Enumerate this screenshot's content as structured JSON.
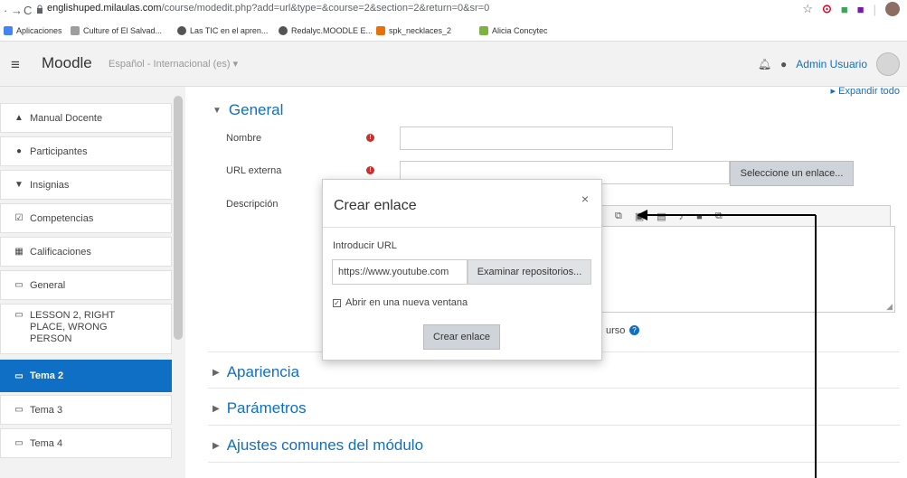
{
  "browser": {
    "url_host": "englishuped.milaulas.com",
    "url_path": "/course/modedit.php?add=url&type=&course=2&section=2&return=0&sr=0",
    "bookmarks": [
      {
        "label": "Aplicaciones",
        "color": "#4285f4"
      },
      {
        "label": "Culture of El Salvad...",
        "color": "#9e9e9e"
      },
      {
        "label": "Las TIC en el apren...",
        "color": "#555555"
      },
      {
        "label": "Redalyc.MOODLE E...",
        "color": "#555555"
      },
      {
        "label": "spk_necklaces_2",
        "color": "#e8710a"
      },
      {
        "label": "Alicia Concytec",
        "color": "#7cb342"
      }
    ]
  },
  "navbar": {
    "brand": "Moodle",
    "language": "Español - Internacional (es) ▾",
    "user": "Admin Usuario"
  },
  "sidebar": {
    "items": [
      {
        "label": "Manual Docente",
        "icon": "hat-icon"
      },
      {
        "label": "Participantes",
        "icon": "users-icon"
      },
      {
        "label": "Insignias",
        "icon": "shield-icon"
      },
      {
        "label": "Competencias",
        "icon": "check-square-icon"
      },
      {
        "label": "Calificaciones",
        "icon": "table-icon"
      },
      {
        "label": "General",
        "icon": "folder-icon"
      },
      {
        "label": "LESSON 2, RIGHT PLACE, WRONG PERSON",
        "icon": "folder-icon"
      },
      {
        "label": "Tema 2",
        "icon": "folder-icon",
        "active": true
      },
      {
        "label": "Tema 3",
        "icon": "folder-icon"
      },
      {
        "label": "Tema 4",
        "icon": "folder-icon"
      }
    ]
  },
  "main": {
    "expand_all": "▸ Expandir todo",
    "general": {
      "heading": "General",
      "name_label": "Nombre",
      "url_label": "URL externa",
      "select_link_button": "Seleccione un enlace...",
      "description_label": "Descripción",
      "show_desc_fragment": "urso"
    },
    "sections": [
      "Apariencia",
      "Parámetros",
      "Ajustes comunes del módulo"
    ]
  },
  "modal": {
    "title": "Crear enlace",
    "close": "×",
    "url_label": "Introducir URL",
    "url_value": "https://www.youtube.com",
    "browse_button": "Examinar repositorios...",
    "new_window_label": "Abrir en una nueva ventana",
    "new_window_checked": true,
    "create_button": "Crear enlace"
  },
  "colors": {
    "accent": "#0f6fc5",
    "required": "#c9302c"
  }
}
